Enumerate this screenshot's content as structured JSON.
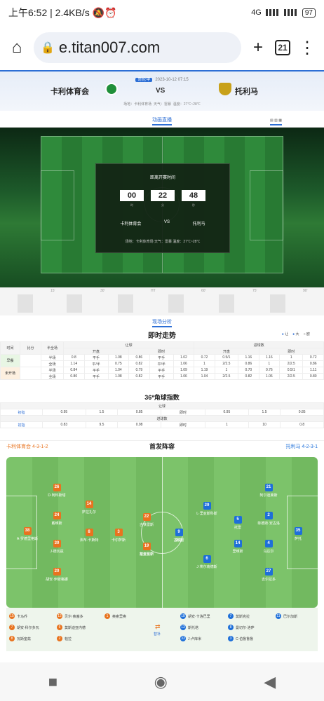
{
  "status": {
    "time": "上午6:52",
    "speed": "2.4KB/s",
    "network": "4G",
    "battery": "97"
  },
  "browser": {
    "url": "e.titan007.com",
    "tab_count": "21"
  },
  "match": {
    "league": "哥伦甲",
    "datetime": "2023-10-12 07:15",
    "home": "卡利体育会",
    "vs": "VS",
    "away": "托利马",
    "venue": "场地：卡利体育场",
    "weather": "天气：雷暴",
    "temp": "温度：27℃~28℃"
  },
  "live": {
    "tab": "动画直播",
    "toggles": "▤ ▥ ▦"
  },
  "countdown": {
    "title": "距离开赛时间",
    "hours": "00",
    "minutes": "22",
    "seconds": "48",
    "u_h": "时",
    "u_m": "分",
    "u_s": "秒",
    "home": "卡利体育会",
    "vs": "VS",
    "away": "托利马",
    "info": "场地：卡利体育场 天气：雷暴 温度：27℃~28℃"
  },
  "timeline": [
    "15'",
    "30'",
    "HT",
    "60'",
    "75'",
    "90'"
  ],
  "analysis": {
    "tab": "现场分析",
    "trend_title": "即时走势",
    "opt_let": "让",
    "opt_big": "大",
    "opt_euro": "欧"
  },
  "odds": {
    "h_time": "时间",
    "h_score": "比分",
    "h_half": "半全场",
    "h_handicap": "让球",
    "h_ou": "进球数",
    "h_open": "开盘",
    "h_live": "即时",
    "rows": [
      {
        "time": "早餐",
        "half": "半场",
        "c": [
          "0.8",
          "平手",
          "1.08",
          "0.86",
          "平手",
          "1.02",
          "0.72",
          "0.5/1",
          "1.16",
          "1.16",
          "1",
          "0.72"
        ]
      },
      {
        "time": "",
        "half": "全场",
        "c": [
          "1.14",
          "平/半",
          "0.75",
          "0.82",
          "平/半",
          "1.06",
          "1",
          "2/2.5",
          "0.86",
          "1",
          "2/2.5",
          "0.86"
        ]
      },
      {
        "time": "未开场",
        "half": "半场",
        "c": [
          "0.84",
          "平手",
          "1.04",
          "0.79",
          "平手",
          "1.09",
          "1.19",
          "1",
          "0.70",
          "0.76",
          "0.5/1",
          "1.11"
        ]
      },
      {
        "time": "",
        "half": "全场",
        "c": [
          "0.80",
          "平手",
          "1.08",
          "0.82",
          "平手",
          "1.06",
          "1.04",
          "2/2.5",
          "0.82",
          "1.06",
          "2/2.5",
          "0.80"
        ]
      }
    ]
  },
  "corners": {
    "title": "36*角球指数",
    "handicap_label": "让球",
    "ou_label": "进球数",
    "rows": [
      {
        "label": "初指",
        "c": [
          "0.95",
          "1.5",
          "0.85",
          "即时",
          "0.95",
          "1.5",
          "0.85"
        ]
      },
      {
        "label": "初指",
        "c": [
          "0.83",
          "9.5",
          "0.98",
          "即时",
          "1",
          "10",
          "0.8"
        ]
      }
    ]
  },
  "lineup": {
    "title": "首发阵容",
    "home_name": "卡利体育会",
    "home_form": "4-3-1-2",
    "away_name": "托利马",
    "away_form": "4-2-3-1",
    "home_color": "#e8731f",
    "away_color": "#1e6fd9",
    "home_players": [
      {
        "n": "38",
        "name": "A·罗德里格斯"
      },
      {
        "n": "26",
        "name": "D·阿科斯塔"
      },
      {
        "n": "24",
        "name": "戴维斯"
      },
      {
        "n": "30",
        "name": "J·德瓦兹"
      },
      {
        "n": "20",
        "name": "胡安·伊斯格娜"
      },
      {
        "n": "14",
        "name": "萨拉扎尔"
      },
      {
        "n": "8",
        "name": "法布·卡斯特"
      },
      {
        "n": "3",
        "name": "卡尔萨斯"
      },
      {
        "n": "22",
        "name": "古铁雷斯"
      },
      {
        "n": "9",
        "name": "拉米雷斯"
      },
      {
        "n": "19",
        "name": "蒂亚瓦尔"
      }
    ],
    "away_players": [
      {
        "n": "35",
        "name": "萨托"
      },
      {
        "n": "21",
        "name": "阿尔迪莱斯"
      },
      {
        "n": "2",
        "name": "菲德斯·安古洛"
      },
      {
        "n": "4",
        "name": "乌达尔"
      },
      {
        "n": "27",
        "name": "吉尔拉多"
      },
      {
        "n": "5",
        "name": "托雷"
      },
      {
        "n": "14",
        "name": "里维斯"
      },
      {
        "n": "29",
        "name": "L·里亚斯科斯"
      },
      {
        "n": "20",
        "name": "古铁雷"
      },
      {
        "n": "6",
        "name": "J·埃尔南德斯"
      },
      {
        "n": "9",
        "name": "朗格"
      }
    ],
    "home_subs": [
      {
        "n": "15",
        "name": "卡马乔"
      },
      {
        "n": "7",
        "name": "胡安·科尔多瓦"
      },
      {
        "n": "8",
        "name": "瓦斯奎兹"
      },
      {
        "n": "12",
        "name": "贝尔·索塞多"
      },
      {
        "n": "6",
        "name": "莫斯迪亚内德"
      },
      {
        "n": "2",
        "name": "帕拉"
      },
      {
        "n": "1",
        "name": "奥索里奥"
      }
    ],
    "away_subs": [
      {
        "n": "18",
        "name": "胡安·卡洛巴里"
      },
      {
        "n": "13",
        "name": "斯托塔"
      },
      {
        "n": "33",
        "name": "J·卢库米"
      },
      {
        "n": "7",
        "name": "莫斯克拉"
      },
      {
        "n": "8",
        "name": "曼切尔·洛萨"
      },
      {
        "n": "3",
        "name": "C·伯鲁鲁鲁"
      },
      {
        "n": "11",
        "name": "巴尔加斯"
      }
    ],
    "subs_label": "替补"
  }
}
